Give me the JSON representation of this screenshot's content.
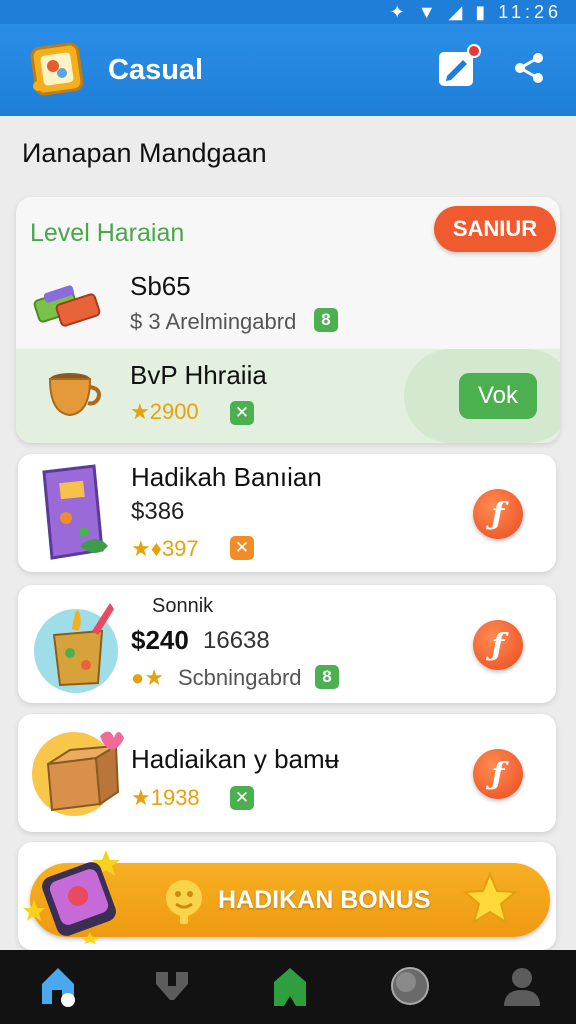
{
  "status_bar": {
    "time": "11:26"
  },
  "app_bar": {
    "title": "Casual",
    "edit_icon": "edit-icon",
    "share_icon": "share-icon"
  },
  "page_title": "Иanapan Mandgaan",
  "featured": {
    "section_label": "Level Haraian",
    "start_button": "SANIUR",
    "items": [
      {
        "title": "Sb65",
        "subtitle": "$ 3 Arelmingabrd",
        "badge": "8",
        "icon": "money-bundle-icon"
      },
      {
        "title": "BvP Hhraiia",
        "price": "★2900",
        "badge": "✕",
        "icon": "cup-icon"
      }
    ],
    "watch_button": "Vok"
  },
  "offers": [
    {
      "title": "Hadikah Banıian",
      "price": "$386",
      "rating": "★♦397",
      "badge": "✕",
      "icon": "gift-box-icon"
    },
    {
      "subtitle_top": "Sonnik",
      "title": "$240",
      "title_extra": "16638",
      "rating_stars": "●★",
      "subtitle": "Scbningabrd",
      "badge": "8",
      "icon": "gift-pot-icon"
    },
    {
      "title": "Hadiaikan y bamʉ",
      "price": "★1938",
      "badge": "✕",
      "icon": "parcel-box-icon"
    }
  ],
  "bonus": {
    "label": "HADIKAN BONUS"
  },
  "colors": {
    "primary": "#1f7fd8",
    "accent_orange": "#ef5a2e",
    "accent_green": "#4caf50",
    "gold": "#e8a10e",
    "banner": "#f7b023"
  },
  "bottom_nav": [
    "home-icon",
    "swap-icon",
    "house-green-icon",
    "globe-icon",
    "profile-icon"
  ]
}
